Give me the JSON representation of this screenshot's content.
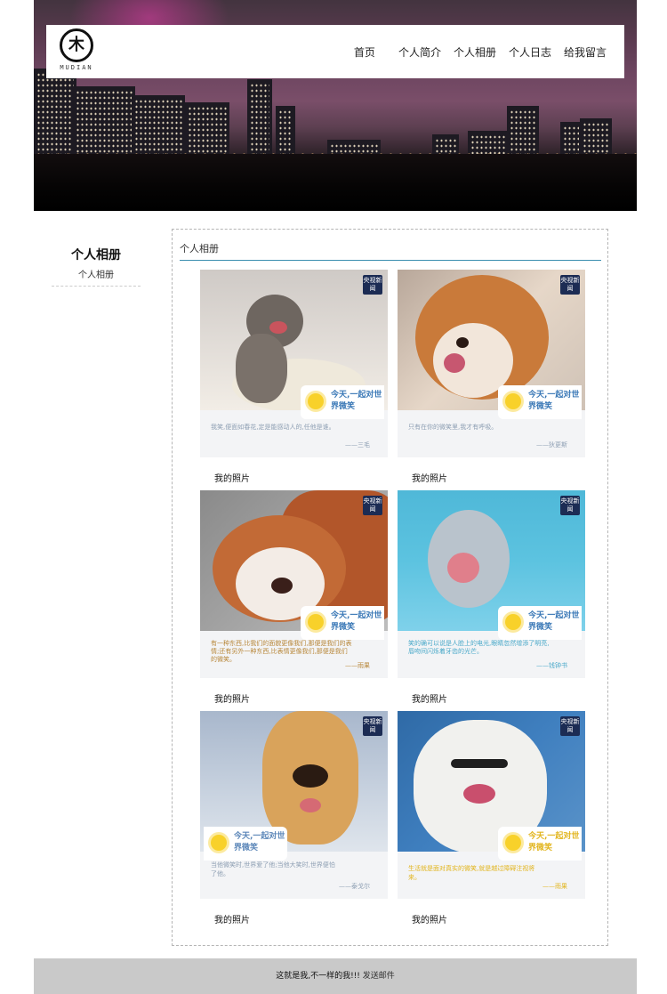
{
  "nav": {
    "logo_text": "MUDIAN",
    "logo_glyph": "木",
    "items": [
      "首页",
      "个人简介",
      "个人相册",
      "个人日志",
      "给我留言"
    ]
  },
  "sidebar": {
    "title": "个人相册",
    "link": "个人相册"
  },
  "panel": {
    "title": "个人相册"
  },
  "photos": [
    {
      "label": "我的照片",
      "badge": "央视新闻",
      "sticker": "今天,一起对世界微笑",
      "quote": "我笑,便面如春花,定是能感动人的,任他是谁。",
      "author": "——三毛"
    },
    {
      "label": "我的照片",
      "badge": "央视新闻",
      "sticker": "今天,一起对世界微笑",
      "quote": "只有在你的微笑里,我才有呼吸。",
      "author": "——狄更斯"
    },
    {
      "label": "我的照片",
      "badge": "央视新闻",
      "sticker": "今天,一起对世界微笑",
      "quote": "有一种东西,比我们的面貌更像我们,那便是我们的表情;还有另外一种东西,比表情更像我们,那便是我们的微笑。",
      "author": "——雨果"
    },
    {
      "label": "我的照片",
      "badge": "央视新闻",
      "sticker": "今天,一起对世界微笑",
      "quote": "笑的确可以说是人脸上的电光,眼睛忽然增添了明亮,唇吻间闪烁着牙齿的光芒。",
      "author": "——钱钟书"
    },
    {
      "label": "我的照片",
      "badge": "央视新闻",
      "sticker": "今天,一起对世界微笑",
      "quote": "当他微笑时,世界爱了他;当他大笑时,世界便怕了他。",
      "author": "——泰戈尔"
    },
    {
      "label": "我的照片",
      "badge": "央视新闻",
      "sticker": "今天,一起对世界微笑",
      "quote": "生活就是面对真实的微笑,就是越过障碍注视将来。",
      "author": "——雨果"
    }
  ],
  "footer": {
    "text": "这就是我,不一样的我!!!",
    "link": "发送邮件"
  },
  "colors": {
    "accent_rule": "#3b8fb0",
    "footer_bg": "#c9c9c9",
    "badge_bg": "#1c2c54"
  }
}
